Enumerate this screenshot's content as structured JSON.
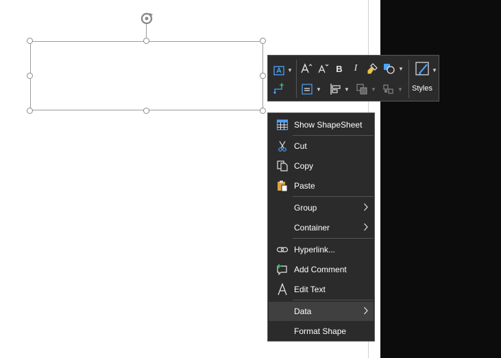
{
  "mini_toolbar": {
    "styles_label": "Styles",
    "icons": [
      "text-box-icon",
      "connector-icon",
      "increase-font-icon",
      "decrease-font-icon",
      "bold-icon",
      "italic-icon",
      "format-painter-icon",
      "fill-color-icon",
      "align-icon",
      "position-icon",
      "bring-forward-icon",
      "group-icon",
      "styles-icon"
    ]
  },
  "context_menu": {
    "items": [
      {
        "label": "Show ShapeSheet",
        "icon": "shapesheet-icon"
      },
      {
        "label": "Cut",
        "icon": "scissors-icon"
      },
      {
        "label": "Copy",
        "icon": "copy-icon"
      },
      {
        "label": "Paste",
        "icon": "paste-icon"
      },
      {
        "label": "Group",
        "submenu": true
      },
      {
        "label": "Container",
        "submenu": true
      },
      {
        "label": "Hyperlink...",
        "icon": "link-icon"
      },
      {
        "label": "Add Comment",
        "icon": "comment-icon"
      },
      {
        "label": "Edit Text",
        "icon": "text-icon"
      },
      {
        "label": "Data",
        "submenu": true,
        "highlighted": true
      },
      {
        "label": "Format Shape"
      }
    ]
  },
  "colors": {
    "menu_bg": "#2b2b2b",
    "menu_hover": "#404040",
    "accent_blue": "#4aa3ff",
    "dark_panel": "#0c0c0c"
  }
}
